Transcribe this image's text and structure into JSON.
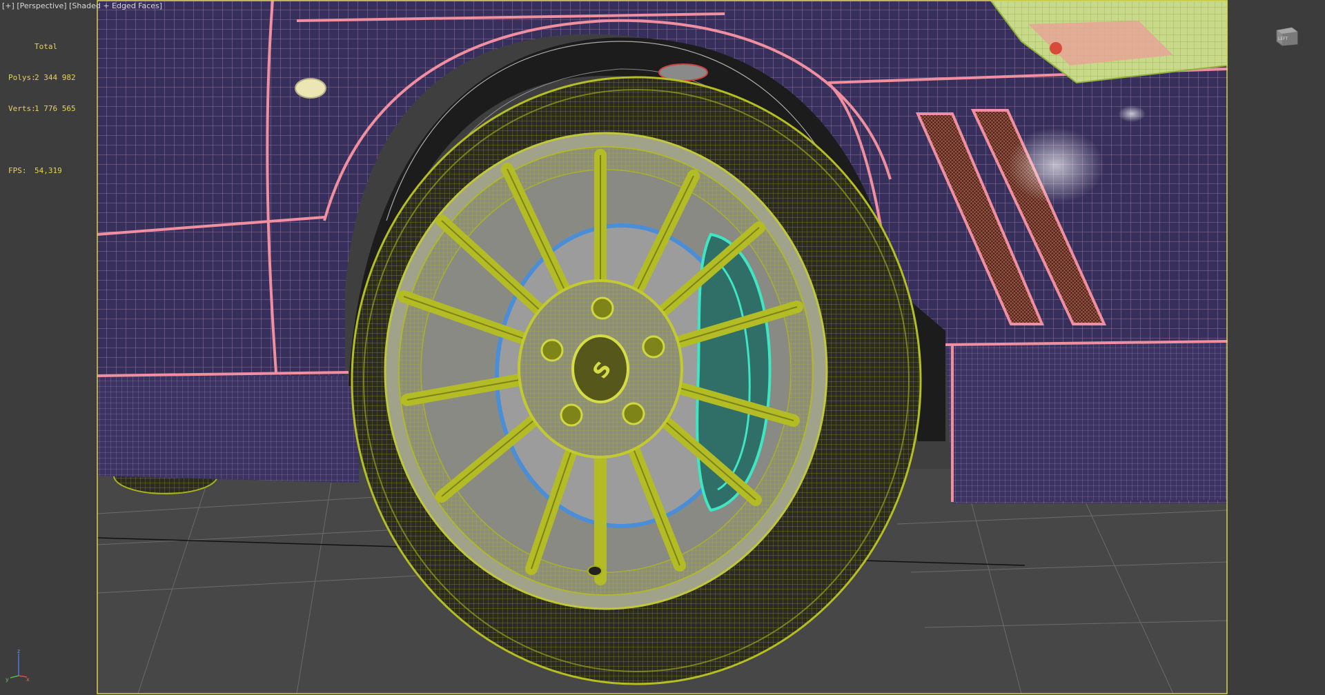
{
  "viewport": {
    "label_plus": "[+]",
    "label_view": "[Perspective]",
    "label_shading": "[Shaded + Edged Faces]"
  },
  "stats": {
    "header": "Total",
    "polys_label": "Polys:",
    "polys_value": "2 344 982",
    "verts_label": "Verts:",
    "verts_value": "1 776 565",
    "fps_label": "FPS:",
    "fps_value": "54,319"
  },
  "viewcube": {
    "face_label": "LEFT"
  },
  "axis": {
    "x": "x",
    "y": "y",
    "z": "z"
  },
  "colors": {
    "background": "#3d3d3d",
    "body_fill": "#3a3460",
    "body_wire": "#e7a3c3",
    "body_edge": "#e98a96",
    "wheel_wire": "#aab21a",
    "tire_fill": "#2f2f2a",
    "rim_fill": "#9a9a8a",
    "caliper": "#3ee6c4",
    "disc_ring": "#4b8ed8",
    "ground": "#4a4a4a",
    "highlight_frame": "#d6d34a",
    "stats_text": "#e8d35a"
  }
}
